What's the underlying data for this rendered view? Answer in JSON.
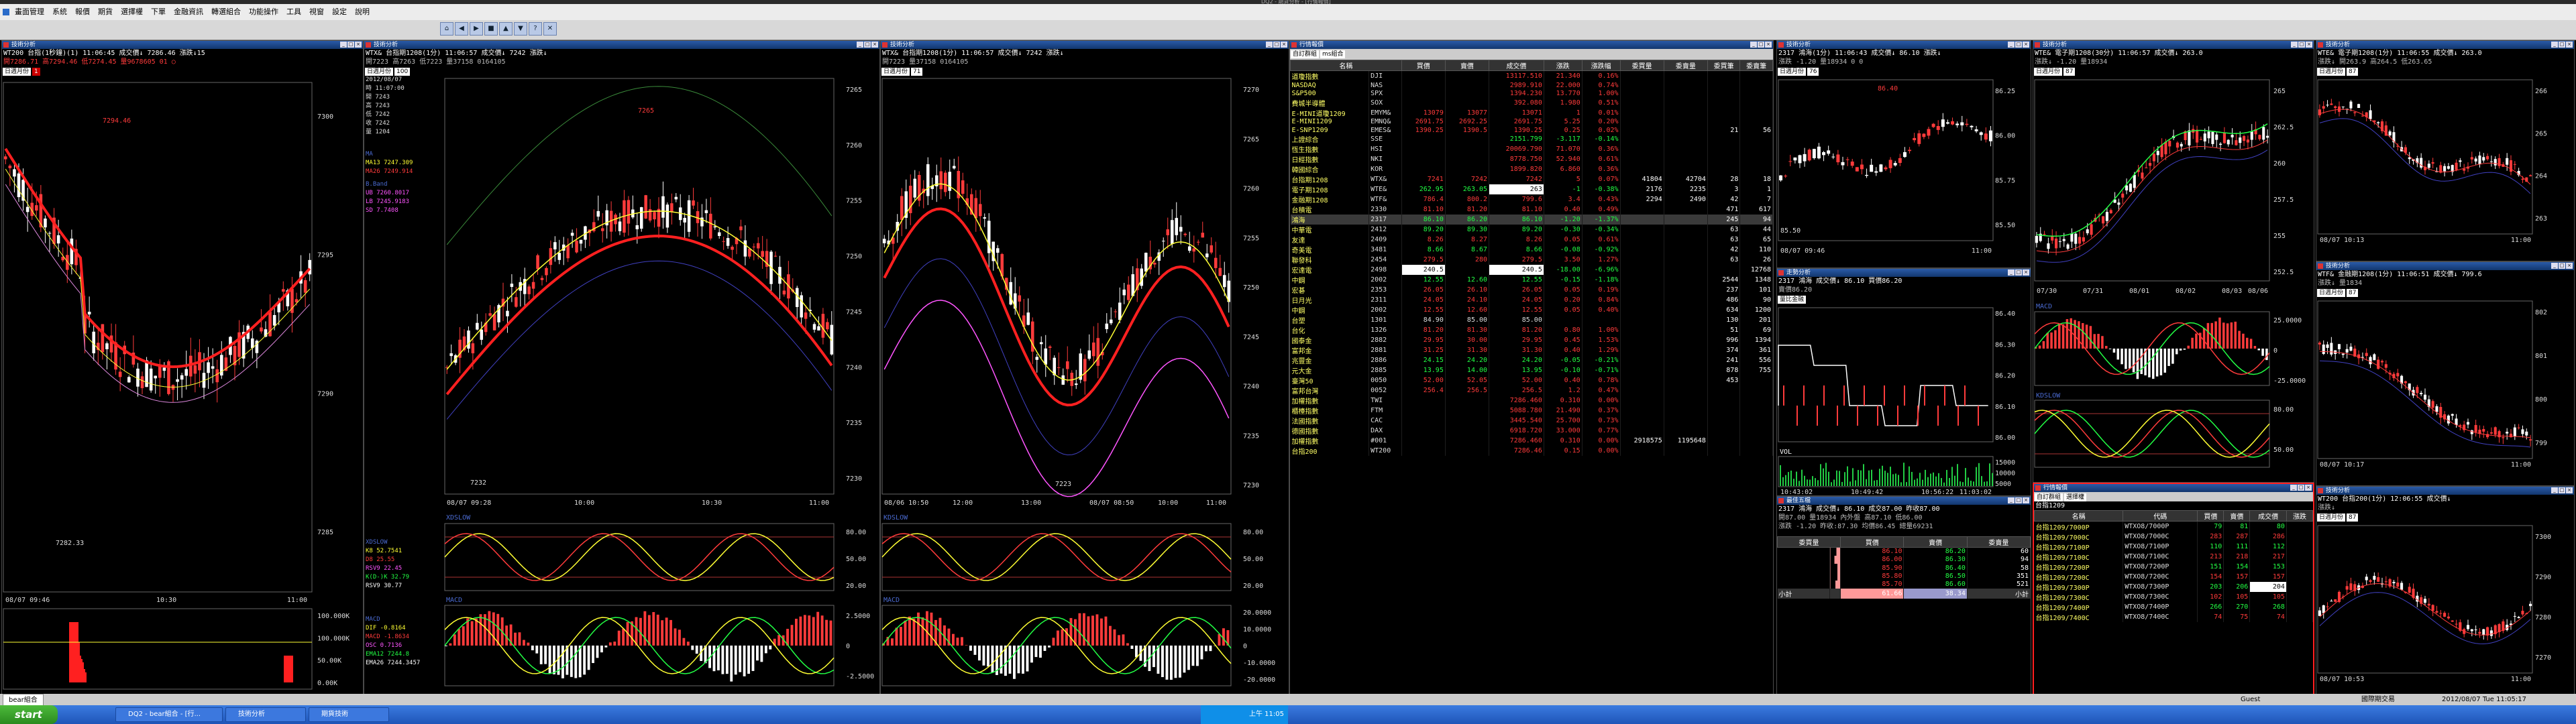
{
  "app": {
    "title": "DQ2 - 期貨分析 - [行情報價]"
  },
  "menu": [
    "畫面管理",
    "系統",
    "報價",
    "期貨",
    "選擇權",
    "下單",
    "金融資訊",
    "轉選組合",
    "功能操作",
    "工具",
    "視窗",
    "設定",
    "說明"
  ],
  "toolbar": [
    "⌂",
    "◀",
    "▶",
    "■",
    "▲",
    "▼",
    "?",
    "✕"
  ],
  "windows": {
    "w1": {
      "title": "技術分析",
      "line1": "WT200  台指(1秒鐘)(1)  11:06:45  成交價↓ 7286.46  漲跌↓15",
      "line2": "開7286.71  高7294.46  低7274.45  量9678605  01 ○",
      "selects": [
        "日週月份",
        "1"
      ],
      "prices": [
        "7300",
        "7295",
        "7290",
        "7285"
      ],
      "labels": {
        "hi": "7294.46",
        "lo": "7282.33"
      },
      "times": [
        "08/07 09:46",
        "10:30",
        "11:00"
      ],
      "vol": [
        "100.000K",
        "100.000K",
        "50.00K",
        "0.00K"
      ]
    },
    "w2": {
      "title": "技術分析",
      "line1": "WTX& 台指期1208(1分)  11:06:57  成交價↓ 7242  漲跌↓",
      "line2": "開7223  高7263  低7223  量37158  0164105",
      "selects": [
        "日週月份",
        "100"
      ],
      "prices": [
        "7265",
        "7260",
        "7255",
        "7250",
        "7245",
        "7240",
        "7235",
        "7230"
      ],
      "labels": {
        "hi": "7265",
        "lo": "7232"
      },
      "times": [
        "08/07 09:28",
        "10:00",
        "10:30",
        "11:00"
      ],
      "side": [
        [
          "2012/08/07",
          ""
        ],
        [
          "時",
          "11:07:00"
        ],
        [
          "開",
          "7243"
        ],
        [
          "高",
          "7243"
        ],
        [
          "低",
          "7242"
        ],
        [
          "收",
          "7242"
        ],
        [
          "量",
          "1204"
        ]
      ],
      "ma": [
        "MA",
        "MA13 7247.309",
        "MA26 7249.914"
      ],
      "bband": [
        "B.Band",
        "UB 7260.8017",
        "LB 7245.9183",
        "SD 7.7408"
      ],
      "kd_label": "XDSLOW",
      "kd": [
        "K8 52.7541",
        "D8 25.55",
        "RSV9 22.45",
        "K(D-)K 32.79",
        "RSV9 30.77"
      ],
      "kd_ticks": [
        "80.00",
        "50.00",
        "20.00"
      ],
      "macd_label": "MACD",
      "macd": [
        "DIF -0.8164",
        "MACD -1.8634",
        "OSC 0.7136",
        "EMA12 7244.8",
        "EMA26 7244.3457"
      ],
      "macd_ticks": [
        "2.5000",
        "0",
        "-2.5000"
      ]
    },
    "w3": {
      "title": "技術分析",
      "line1": "WTX& 台指期1208(1分)  11:06:57  成交價↓ 7242  漲跌↓",
      "line2": "開7223  量37158  0164105",
      "selects": [
        "日週月份",
        "71"
      ],
      "prices": [
        "7270",
        "7265",
        "7260",
        "7255",
        "7250",
        "7245",
        "7240",
        "7235",
        "7230"
      ],
      "labels": {
        "lo": "7223"
      },
      "times": [
        "08/06 10:50",
        "12:00",
        "13:00",
        "08/07 08:50",
        "10:00",
        "11:00"
      ],
      "kd_label": "KDSLOW",
      "kd_ticks": [
        "80.00",
        "50.00",
        "20.00"
      ],
      "macd_label": "MACD",
      "macd_ticks": [
        "20.0000",
        "10.0000",
        "0",
        "-10.0000",
        "-20.0000"
      ]
    },
    "w4": {
      "title": "行情報價",
      "toolbar": [
        "自訂群組",
        "ms組合"
      ],
      "headers": [
        "名稱",
        "買價",
        "賣價",
        "成交價",
        "漲跌",
        "漲跌幅",
        "委買量",
        "委賣量",
        "委買筆",
        "委賣筆"
      ],
      "rows": [
        [
          "道瓊指數",
          "DJI",
          "",
          "",
          "13117.510",
          "21.340",
          "0.16%",
          "",
          "",
          "",
          ""
        ],
        [
          "NASDAQ",
          "NAS",
          "",
          "",
          "2989.910",
          "22.000",
          "0.74%",
          "",
          "",
          "",
          ""
        ],
        [
          "S&P500",
          "SPX",
          "",
          "",
          "1394.230",
          "13.770",
          "1.00%",
          "",
          "",
          "",
          ""
        ],
        [
          "費城半導體",
          "SOX",
          "",
          "",
          "392.080",
          "1.980",
          "0.51%",
          "",
          "",
          "",
          ""
        ],
        [
          "E-MINI道瓊1209",
          "EMYM&",
          "13079",
          "13077",
          "13071",
          "1",
          "0.01%",
          "",
          "",
          "",
          ""
        ],
        [
          "E-MINI1209",
          "EMNQ&",
          "2691.75",
          "2692.25",
          "2691.75",
          "5.25",
          "0.20%",
          "",
          "",
          "",
          ""
        ],
        [
          "E-SNP1209",
          "EMES&",
          "1390.25",
          "1390.5",
          "1390.25",
          "0.25",
          "0.02%",
          "",
          "",
          "21",
          "56"
        ],
        [
          "上證綜合",
          "SSE",
          "",
          "",
          "2151.799",
          "-3.117",
          "-0.14%",
          "",
          "",
          "",
          ""
        ],
        [
          "恆生指數",
          "HSI",
          "",
          "",
          "20069.790",
          "71.070",
          "0.36%",
          "",
          "",
          "",
          ""
        ],
        [
          "日經指數",
          "NKI",
          "",
          "",
          "8778.750",
          "52.940",
          "0.61%",
          "",
          "",
          "",
          ""
        ],
        [
          "韓國綜合",
          "KOR",
          "",
          "",
          "1899.820",
          "6.860",
          "0.36%",
          "",
          "",
          "",
          ""
        ],
        [
          "台指期1208",
          "WTX&",
          "7241",
          "7242",
          "7242",
          "5",
          "0.07%",
          "41804",
          "42704",
          "28",
          "18"
        ],
        [
          "電子期1208",
          "WTE&",
          "262.95",
          "263.05",
          "263",
          "-1",
          "-0.38%",
          "2176",
          "2235",
          "3",
          "1"
        ],
        [
          "金融期1208",
          "WTF&",
          "786.4",
          "800.2",
          "799.6",
          "3.4",
          "0.43%",
          "2294",
          "2490",
          "42",
          "7"
        ],
        [
          "台積電",
          "2330",
          "81.10",
          "81.20",
          "81.10",
          "0.40",
          "0.49%",
          "",
          "",
          "471",
          "617"
        ],
        [
          "鴻海",
          "2317",
          "86.10",
          "86.20",
          "86.10",
          "-1.20",
          "-1.37%",
          "",
          "",
          "245",
          "94"
        ],
        [
          "中華電",
          "2412",
          "89.20",
          "89.30",
          "89.20",
          "-0.30",
          "-0.34%",
          "",
          "",
          "63",
          "44"
        ],
        [
          "友達",
          "2409",
          "8.26",
          "8.27",
          "8.26",
          "0.05",
          "0.61%",
          "",
          "",
          "63",
          "65"
        ],
        [
          "奇美電",
          "3481",
          "8.66",
          "8.67",
          "8.66",
          "-0.08",
          "-0.92%",
          "",
          "",
          "42",
          "110"
        ],
        [
          "聯發科",
          "2454",
          "279.5",
          "280",
          "279.5",
          "3.50",
          "1.27%",
          "",
          "",
          "63",
          "26"
        ],
        [
          "宏達電",
          "2498",
          "240.5",
          "",
          "240.5",
          "-18.00",
          "-6.96%",
          "",
          "",
          "",
          "12768"
        ],
        [
          "中鋼",
          "2002",
          "12.55",
          "12.60",
          "12.55",
          "-0.15",
          "-1.18%",
          "",
          "",
          "2544",
          "1348"
        ],
        [
          "宏碁",
          "2353",
          "26.05",
          "26.10",
          "26.05",
          "0.05",
          "0.19%",
          "",
          "",
          "237",
          "101"
        ],
        [
          "日月光",
          "2311",
          "24.05",
          "24.10",
          "24.05",
          "0.20",
          "0.84%",
          "",
          "",
          "486",
          "90"
        ],
        [
          "中鋼",
          "2002",
          "12.55",
          "12.60",
          "12.55",
          "0.05",
          "0.40%",
          "",
          "",
          "634",
          "1200"
        ],
        [
          "台塑",
          "1301",
          "84.90",
          "85.00",
          "85.00",
          "",
          "",
          "",
          "",
          "130",
          "201"
        ],
        [
          "台化",
          "1326",
          "81.20",
          "81.30",
          "81.20",
          "0.80",
          "1.00%",
          "",
          "",
          "51",
          "69"
        ],
        [
          "國泰金",
          "2882",
          "29.95",
          "30.00",
          "29.95",
          "0.45",
          "1.53%",
          "",
          "",
          "996",
          "1394"
        ],
        [
          "富邦金",
          "2881",
          "31.25",
          "31.30",
          "31.30",
          "0.40",
          "1.29%",
          "",
          "",
          "374",
          "361"
        ],
        [
          "兆豐金",
          "2886",
          "24.15",
          "24.20",
          "24.20",
          "-0.05",
          "-0.21%",
          "",
          "",
          "241",
          "556"
        ],
        [
          "元大金",
          "2885",
          "13.95",
          "14.00",
          "13.95",
          "-0.10",
          "-0.71%",
          "",
          "",
          "878",
          "755"
        ],
        [
          "臺灣50",
          "0050",
          "52.00",
          "52.05",
          "52.00",
          "0.40",
          "0.78%",
          "",
          "",
          "453",
          "",
          ""
        ],
        [
          "富邦台灣",
          "0052",
          "256.4",
          "256.5",
          "256.5",
          "1.2",
          "0.47%",
          "",
          "",
          "",
          ""
        ],
        [
          "加權指數",
          "TWI",
          "",
          "",
          "7286.460",
          "0.310",
          "0.00%",
          "",
          "",
          "",
          ""
        ],
        [
          "櫃檯指數",
          "FTM",
          "",
          "",
          "5088.780",
          "21.490",
          "0.37%",
          "",
          "",
          "",
          ""
        ],
        [
          "法國指數",
          "CAC",
          "",
          "",
          "3445.540",
          "25.700",
          "0.73%",
          "",
          "",
          "",
          ""
        ],
        [
          "德國指數",
          "DAX",
          "",
          "",
          "6918.720",
          "33.000",
          "0.77%",
          "",
          "",
          "",
          ""
        ],
        [
          "加權指數",
          "#001",
          "",
          "",
          "7286.460",
          "0.310",
          "0.00%",
          "2918575",
          "1195648",
          "",
          ""
        ],
        [
          "台指200",
          "WT200",
          "",
          "",
          "7286.46",
          "0.15",
          "0.00%",
          "",
          "",
          "",
          ""
        ]
      ]
    },
    "w5": {
      "title": "技術分析",
      "line1": "2317  鴻海(1分)  11:06:43  成交價↓ 86.10  漲跌↓",
      "line2": "漲跌 -1.20  量18934  0  0",
      "selects": [
        "日週月份",
        "76"
      ],
      "prices": [
        "86.25",
        "86.00",
        "85.75",
        "85.50"
      ],
      "labels": {
        "hi": "86.40",
        "lo": "85.50"
      },
      "times": [
        "08/07 09:46",
        "11:00"
      ]
    },
    "w6": {
      "title": "走勢分析",
      "line1": "2317 鴻海  成交價↓ 86.10  買價86.20",
      "line2": "賣價86.20",
      "tab": "量比金融",
      "prices": [
        "86.40",
        "86.30",
        "86.20",
        "86.10",
        "86.00"
      ],
      "vol_label": "VOL",
      "vol_ticks": [
        "15000",
        "10000",
        "5000"
      ],
      "times": [
        "10:43:02",
        "10:49:42",
        "10:56:22",
        "11:03:02"
      ]
    },
    "w7": {
      "title": "最佳五檔",
      "line1": "2317 鴻海  成交價↓ 86.10  成交87.00  昨收87.00",
      "line2": "開87.00  量18934  內外盤 高87.10  低86.00",
      "line3": "漲跌 -1.20  昨收:87.30  均價86.45  總量69231",
      "headers": [
        "委買量",
        "買價",
        "賣價",
        "委賣量"
      ],
      "rows": [
        [
          "",
          "",
          " 86.10",
          "86.20",
          "60"
        ],
        [
          "",
          "",
          "86.00",
          "86.30",
          "94"
        ],
        [
          "",
          "",
          "85.90",
          "86.40",
          "58"
        ],
        [
          "",
          "",
          "85.80",
          "86.50",
          "351"
        ],
        [
          "",
          "",
          "85.70",
          "86.60",
          "521"
        ]
      ],
      "footer": [
        "小計",
        "",
        "61.66",
        "38.34",
        "小計"
      ]
    },
    "w8": {
      "title": "技術分析",
      "line1": "WTE& 電子期1208(30分)  11:06:57  成交價↓ 263.0",
      "line2": "漲跌↓ -1.20  量18934",
      "selects": [
        "日週月份",
        "87"
      ],
      "prices": [
        "265",
        "262.5",
        "260",
        "257.5",
        "255",
        "252.5"
      ],
      "times": [
        "07/30",
        "07/31",
        "08/01",
        "08/02",
        "08/03",
        "08/06"
      ],
      "macd_label": "MACD",
      "macd_ticks": [
        "25.0000",
        "0",
        "-25.0000"
      ],
      "kd_label": "KDSLOW",
      "kd_ticks": [
        "80.00",
        "50.00"
      ]
    },
    "w9": {
      "title": "行情報價",
      "toolbar": [
        "自訂群組",
        "選擇權"
      ],
      "sub": "台指1209",
      "headers": [
        "名稱",
        "代碼",
        "買價",
        "賣價",
        "成交價",
        "漲跌"
      ],
      "rows": [
        [
          "台指1209/7000P",
          "WTXO8/7000P",
          "79",
          "81",
          "80",
          ""
        ],
        [
          "台指1209/7000C",
          "WTXO8/7000C",
          "283",
          "287",
          "286",
          ""
        ],
        [
          "台指1209/7100P",
          "WTXO8/7100P",
          "110",
          "111",
          "112",
          ""
        ],
        [
          "台指1209/7100C",
          "WTXO8/7100C",
          "213",
          "218",
          "217",
          ""
        ],
        [
          "台指1209/7200P",
          "WTXO8/7200P",
          "151",
          "154",
          "153",
          ""
        ],
        [
          "台指1209/7200C",
          "WTXO8/7200C",
          "154",
          "157",
          "157",
          ""
        ],
        [
          "台指1209/7300P",
          "WTXO8/7300P",
          "203",
          "206",
          "204",
          ""
        ],
        [
          "台指1209/7300C",
          "WTXO8/7300C",
          "102",
          "105",
          "105",
          ""
        ],
        [
          "台指1209/7400P",
          "WTXO8/7400P",
          "266",
          "270",
          "268",
          ""
        ],
        [
          "台指1209/7400C",
          "WTXO8/7400C",
          "74",
          "75",
          "74",
          ""
        ]
      ]
    },
    "w10": {
      "title": "技術分析",
      "line1": "WTE& 電子期1208(1分)  11:06:55  成交價↓ 263.0",
      "line2": "漲跌↓ 開263.9  高264.5  低263.65",
      "selects": [
        "日週月份",
        "87"
      ],
      "prices": [
        "266",
        "265",
        "264",
        "263"
      ],
      "times": [
        "08/07 10:13",
        "11:00"
      ]
    },
    "w11": {
      "title": "技術分析",
      "line1": "WTF& 金融期1208(1分)  11:06:51  成交價↓ 799.6",
      "line2": "漲跌↓ 量1834",
      "selects": [
        "日週月份",
        "87"
      ],
      "prices": [
        "802",
        "801",
        "800",
        "799"
      ],
      "times": [
        "08/07 10:17",
        "11:00"
      ]
    },
    "w12": {
      "title": "技術分析",
      "line1": "WT200  台指200(1分)  12:06:55  成交價↓",
      "line2": "漲跌↓",
      "selects": [
        "日週月份",
        "87"
      ],
      "prices": [
        "7300",
        "7290",
        "7280",
        "7270"
      ],
      "times": [
        "08/07 10:53",
        "11:00"
      ]
    }
  },
  "bottom_tab": "bear組合",
  "status": {
    "left": "",
    "user": "Guest",
    "market": "國際期交易",
    "datetime": "2012/08/07 Tue 11:05:17"
  },
  "taskbar": {
    "start": "start",
    "tasks": [
      "DQ2 - bear組合 - [行...",
      "技術分析",
      "期貨技術"
    ],
    "clock": "上午 11:05"
  },
  "colors": {
    "up": "#ff3b3b",
    "down": "#22ff44",
    "flat": "#ffff33",
    "title_bar": "#2a5aa8"
  }
}
